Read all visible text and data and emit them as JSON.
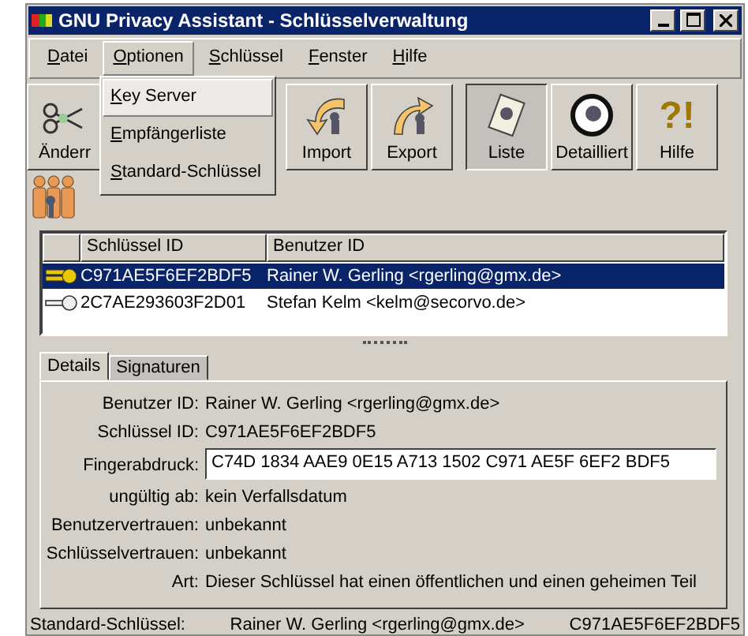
{
  "window": {
    "title": "GNU Privacy Assistant - Schlüsselverwaltung"
  },
  "menu": [
    {
      "label": "Datei",
      "selected": false
    },
    {
      "label": "Optionen",
      "selected": true
    },
    {
      "label": "Schlüssel",
      "selected": false
    },
    {
      "label": "Fenster",
      "selected": false
    },
    {
      "label": "Hilfe",
      "selected": false
    }
  ],
  "dropdown": [
    {
      "label": "Key Server",
      "selected": true
    },
    {
      "label": "Empfängerliste",
      "selected": false
    },
    {
      "label": "Standard-Schlüssel",
      "selected": false
    }
  ],
  "toolbar": [
    {
      "label": "Änderr",
      "kind": "edit",
      "pressed": false
    },
    {
      "label": "Import",
      "kind": "import",
      "pressed": false
    },
    {
      "label": "Export",
      "kind": "export",
      "pressed": false
    },
    {
      "label": "Liste",
      "kind": "list",
      "pressed": true
    },
    {
      "label": "Detailliert",
      "kind": "detail",
      "pressed": false
    },
    {
      "label": "Hilfe",
      "kind": "help",
      "glyph": "?!",
      "pressed": false
    }
  ],
  "key_list": {
    "columns": [
      "Schlüssel ID",
      "Benutzer ID"
    ],
    "rows": [
      {
        "kind": "pair",
        "key_id": "C971AE5F6EF2BDF5",
        "user_id": "Rainer W. Gerling <rgerling@gmx.de>",
        "selected": true
      },
      {
        "kind": "public",
        "key_id": "2C7AE293603F2D01",
        "user_id": "Stefan Kelm <kelm@secorvo.de>",
        "selected": false
      }
    ]
  },
  "tabs": [
    {
      "label": "Details",
      "selected": true
    },
    {
      "label": "Signaturen",
      "selected": false
    }
  ],
  "details": [
    {
      "label": "Benutzer ID:",
      "value": "Rainer W. Gerling <rgerling@gmx.de>",
      "kind": "text"
    },
    {
      "label": "Schlüssel ID:",
      "value": "C971AE5F6EF2BDF5",
      "kind": "text"
    },
    {
      "label": "Fingerabdruck:",
      "value": "C74D 1834 AAE9 0E15 A713  1502 C971 AE5F 6EF2 BDF5",
      "kind": "field"
    },
    {
      "label": "ungültig ab:",
      "value": "kein Verfallsdatum",
      "kind": "text"
    },
    {
      "label": "Benutzervertrauen:",
      "value": "unbekannt",
      "kind": "text"
    },
    {
      "label": "Schlüsselvertrauen:",
      "value": "unbekannt",
      "kind": "text"
    },
    {
      "label": "Art:",
      "value": "Dieser Schlüssel hat einen öffentlichen und einen geheimen Teil",
      "kind": "text"
    }
  ],
  "status_bar": {
    "label": "Standard-Schlüssel:",
    "user": "Rainer W. Gerling <rgerling@gmx.de>",
    "key_id": "C971AE5F6EF2BDF5"
  }
}
